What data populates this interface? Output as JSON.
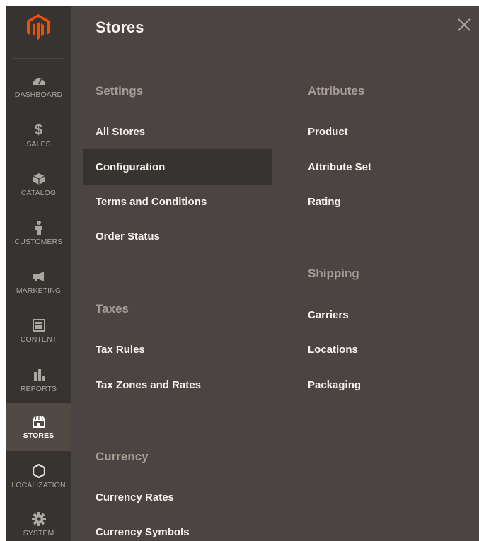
{
  "sidebar": {
    "logo_icon": "magento-logo-icon",
    "items": [
      {
        "label": "DASHBOARD",
        "icon": "dashboard-icon",
        "active": false
      },
      {
        "label": "SALES",
        "icon": "dollar-icon",
        "active": false
      },
      {
        "label": "CATALOG",
        "icon": "box-icon",
        "active": false
      },
      {
        "label": "CUSTOMERS",
        "icon": "person-icon",
        "active": false
      },
      {
        "label": "MARKETING",
        "icon": "megaphone-icon",
        "active": false
      },
      {
        "label": "CONTENT",
        "icon": "layout-icon",
        "active": false
      },
      {
        "label": "REPORTS",
        "icon": "bar-chart-icon",
        "active": false
      },
      {
        "label": "STORES",
        "icon": "storefront-icon",
        "active": true
      },
      {
        "label": "LOCALIZATION",
        "icon": "hexagon-icon",
        "active": false
      },
      {
        "label": "SYSTEM",
        "icon": "gear-icon",
        "active": false
      }
    ]
  },
  "panel": {
    "title": "Stores",
    "close_icon": "close-icon",
    "sections": {
      "settings": {
        "title": "Settings",
        "items": [
          "All Stores",
          "Configuration",
          "Terms and Conditions",
          "Order Status"
        ],
        "hovered": "Configuration"
      },
      "taxes": {
        "title": "Taxes",
        "items": [
          "Tax Rules",
          "Tax Zones and Rates"
        ]
      },
      "currency": {
        "title": "Currency",
        "items": [
          "Currency Rates",
          "Currency Symbols"
        ]
      },
      "attributes": {
        "title": "Attributes",
        "items": [
          "Product",
          "Attribute Set",
          "Rating"
        ]
      },
      "shipping": {
        "title": "Shipping",
        "items": [
          "Carriers",
          "Locations",
          "Packaging"
        ]
      }
    }
  },
  "colors": {
    "sidebar_bg": "#373330",
    "panel_bg": "#4a4542",
    "active_bg": "#514943",
    "brand_orange": "#eb5202",
    "section_title": "#a79d95",
    "link": "#f7f3eb"
  }
}
